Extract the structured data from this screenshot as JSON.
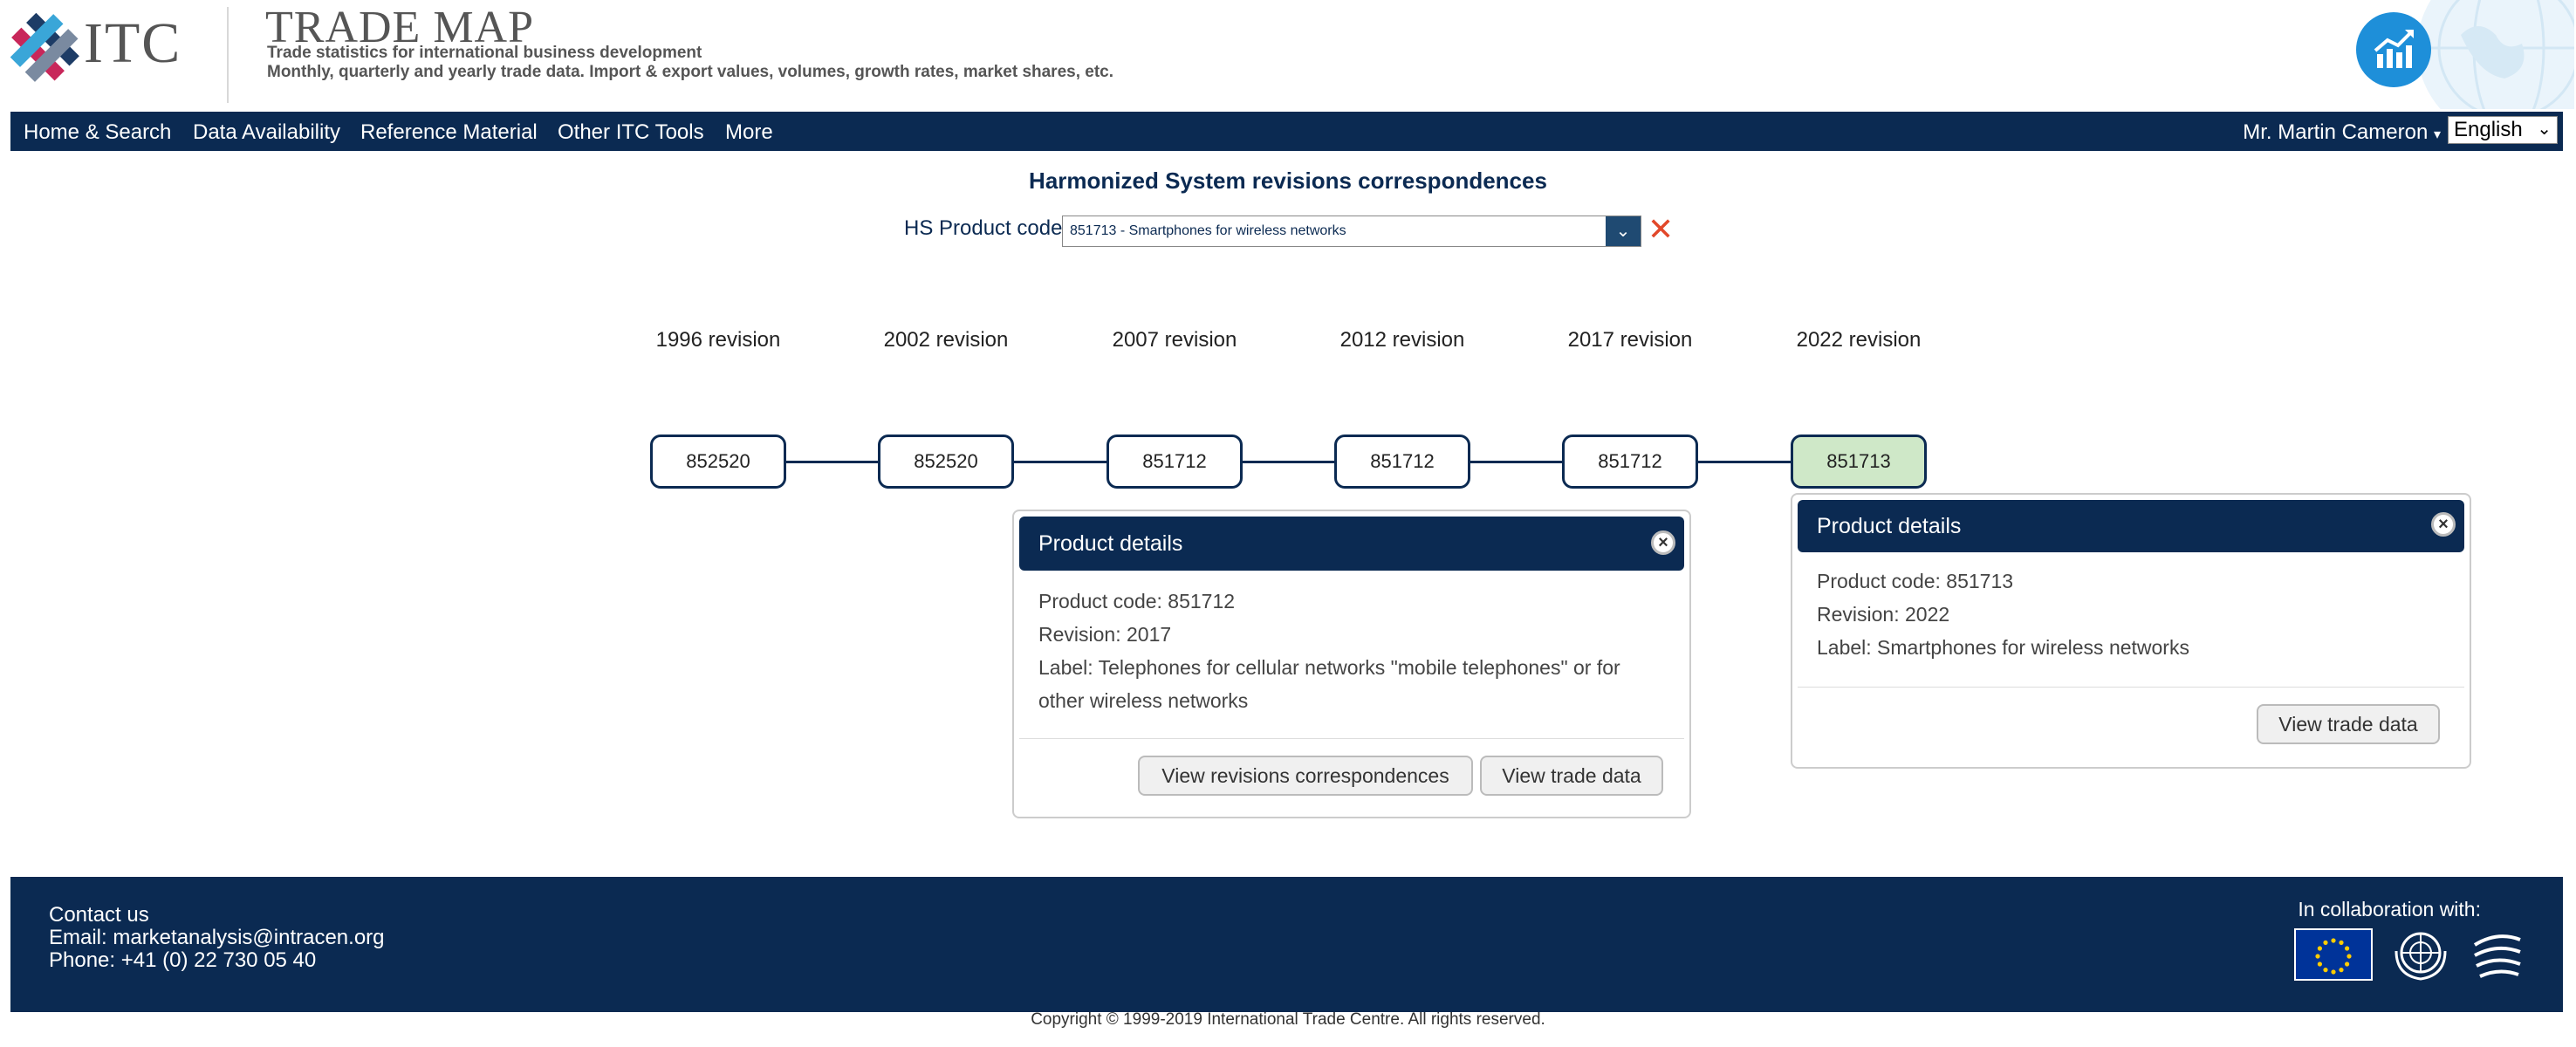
{
  "header": {
    "logo_text": "ITC",
    "title": "TRADE MAP",
    "subtitle1": "Trade statistics for international business development",
    "subtitle2": "Monthly, quarterly and yearly trade data. Import & export values, volumes, growth rates, market shares, etc."
  },
  "nav": {
    "items": [
      "Home & Search",
      "Data Availability",
      "Reference Material",
      "Other ITC Tools",
      "More"
    ],
    "user": "Mr. Martin Cameron",
    "language": "English"
  },
  "page_title": "Harmonized System revisions correspondences",
  "search": {
    "label": "HS Product code",
    "value": "851713 - Smartphones for wireless networks"
  },
  "revisions": [
    {
      "label": "1996 revision",
      "code": "852520"
    },
    {
      "label": "2002 revision",
      "code": "852520"
    },
    {
      "label": "2007 revision",
      "code": "851712"
    },
    {
      "label": "2012 revision",
      "code": "851712"
    },
    {
      "label": "2017 revision",
      "code": "851712"
    },
    {
      "label": "2022 revision",
      "code": "851713"
    }
  ],
  "popup_2017": {
    "title": "Product details",
    "code_line": "Product code: 851712",
    "revision_line": "Revision: 2017",
    "label_line1": "Label: Telephones for cellular networks \"mobile telephones\" or for",
    "label_line2": "other wireless networks",
    "btn_revisions": "View revisions correspondences",
    "btn_trade": "View trade data"
  },
  "popup_2022": {
    "title": "Product details",
    "code_line": "Product code: 851713",
    "revision_line": "Revision: 2022",
    "label_line": "Label: Smartphones for wireless networks",
    "btn_trade": "View trade data"
  },
  "footer": {
    "contact": "Contact us",
    "email": "Email: marketanalysis@intracen.org",
    "phone": "Phone: +41 (0) 22 730 05 40",
    "collab": "In collaboration with:"
  },
  "copyright": "Copyright © 1999-2019 International Trade Centre. All rights reserved.",
  "colors": {
    "navy": "#0b2a52",
    "selected_node": "#cfe8c8",
    "accent_blue": "#1e8fd9",
    "clear_red": "#e2482a"
  },
  "icons": [
    "itc-logo-icon",
    "trade-chart-icon",
    "globe-icon",
    "chevron-down-icon",
    "clear-icon",
    "close-icon",
    "eu-flag-icon",
    "un-emblem-icon",
    "wto-logo-icon"
  ]
}
